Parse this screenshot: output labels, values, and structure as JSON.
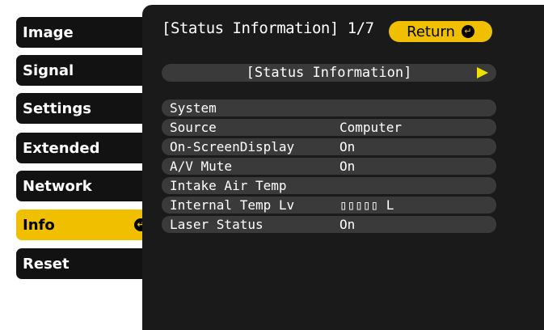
{
  "sidebar": {
    "items": [
      {
        "label": "Image"
      },
      {
        "label": "Signal"
      },
      {
        "label": "Settings"
      },
      {
        "label": "Extended"
      },
      {
        "label": "Network"
      },
      {
        "label": "Info",
        "active": true
      },
      {
        "label": "Reset"
      }
    ]
  },
  "header": {
    "title": "[Status Information] 1/7",
    "return_label": "Return"
  },
  "status_bar": {
    "label": "[Status Information]"
  },
  "info": {
    "rows": [
      {
        "key": "System",
        "value": ""
      },
      {
        "key": "Source",
        "value": "Computer"
      },
      {
        "key": "On-ScreenDisplay",
        "value": "On"
      },
      {
        "key": "A/V Mute",
        "value": "On"
      },
      {
        "key": "Intake Air Temp",
        "value": ""
      },
      {
        "key": "Internal Temp Lv",
        "value": "▯▯▯▯▯ L"
      },
      {
        "key": "Laser Status",
        "value": "On"
      }
    ]
  },
  "colors": {
    "accent": "#f0c000",
    "panel": "#1a1a1a",
    "row": "#3a3a3a"
  }
}
